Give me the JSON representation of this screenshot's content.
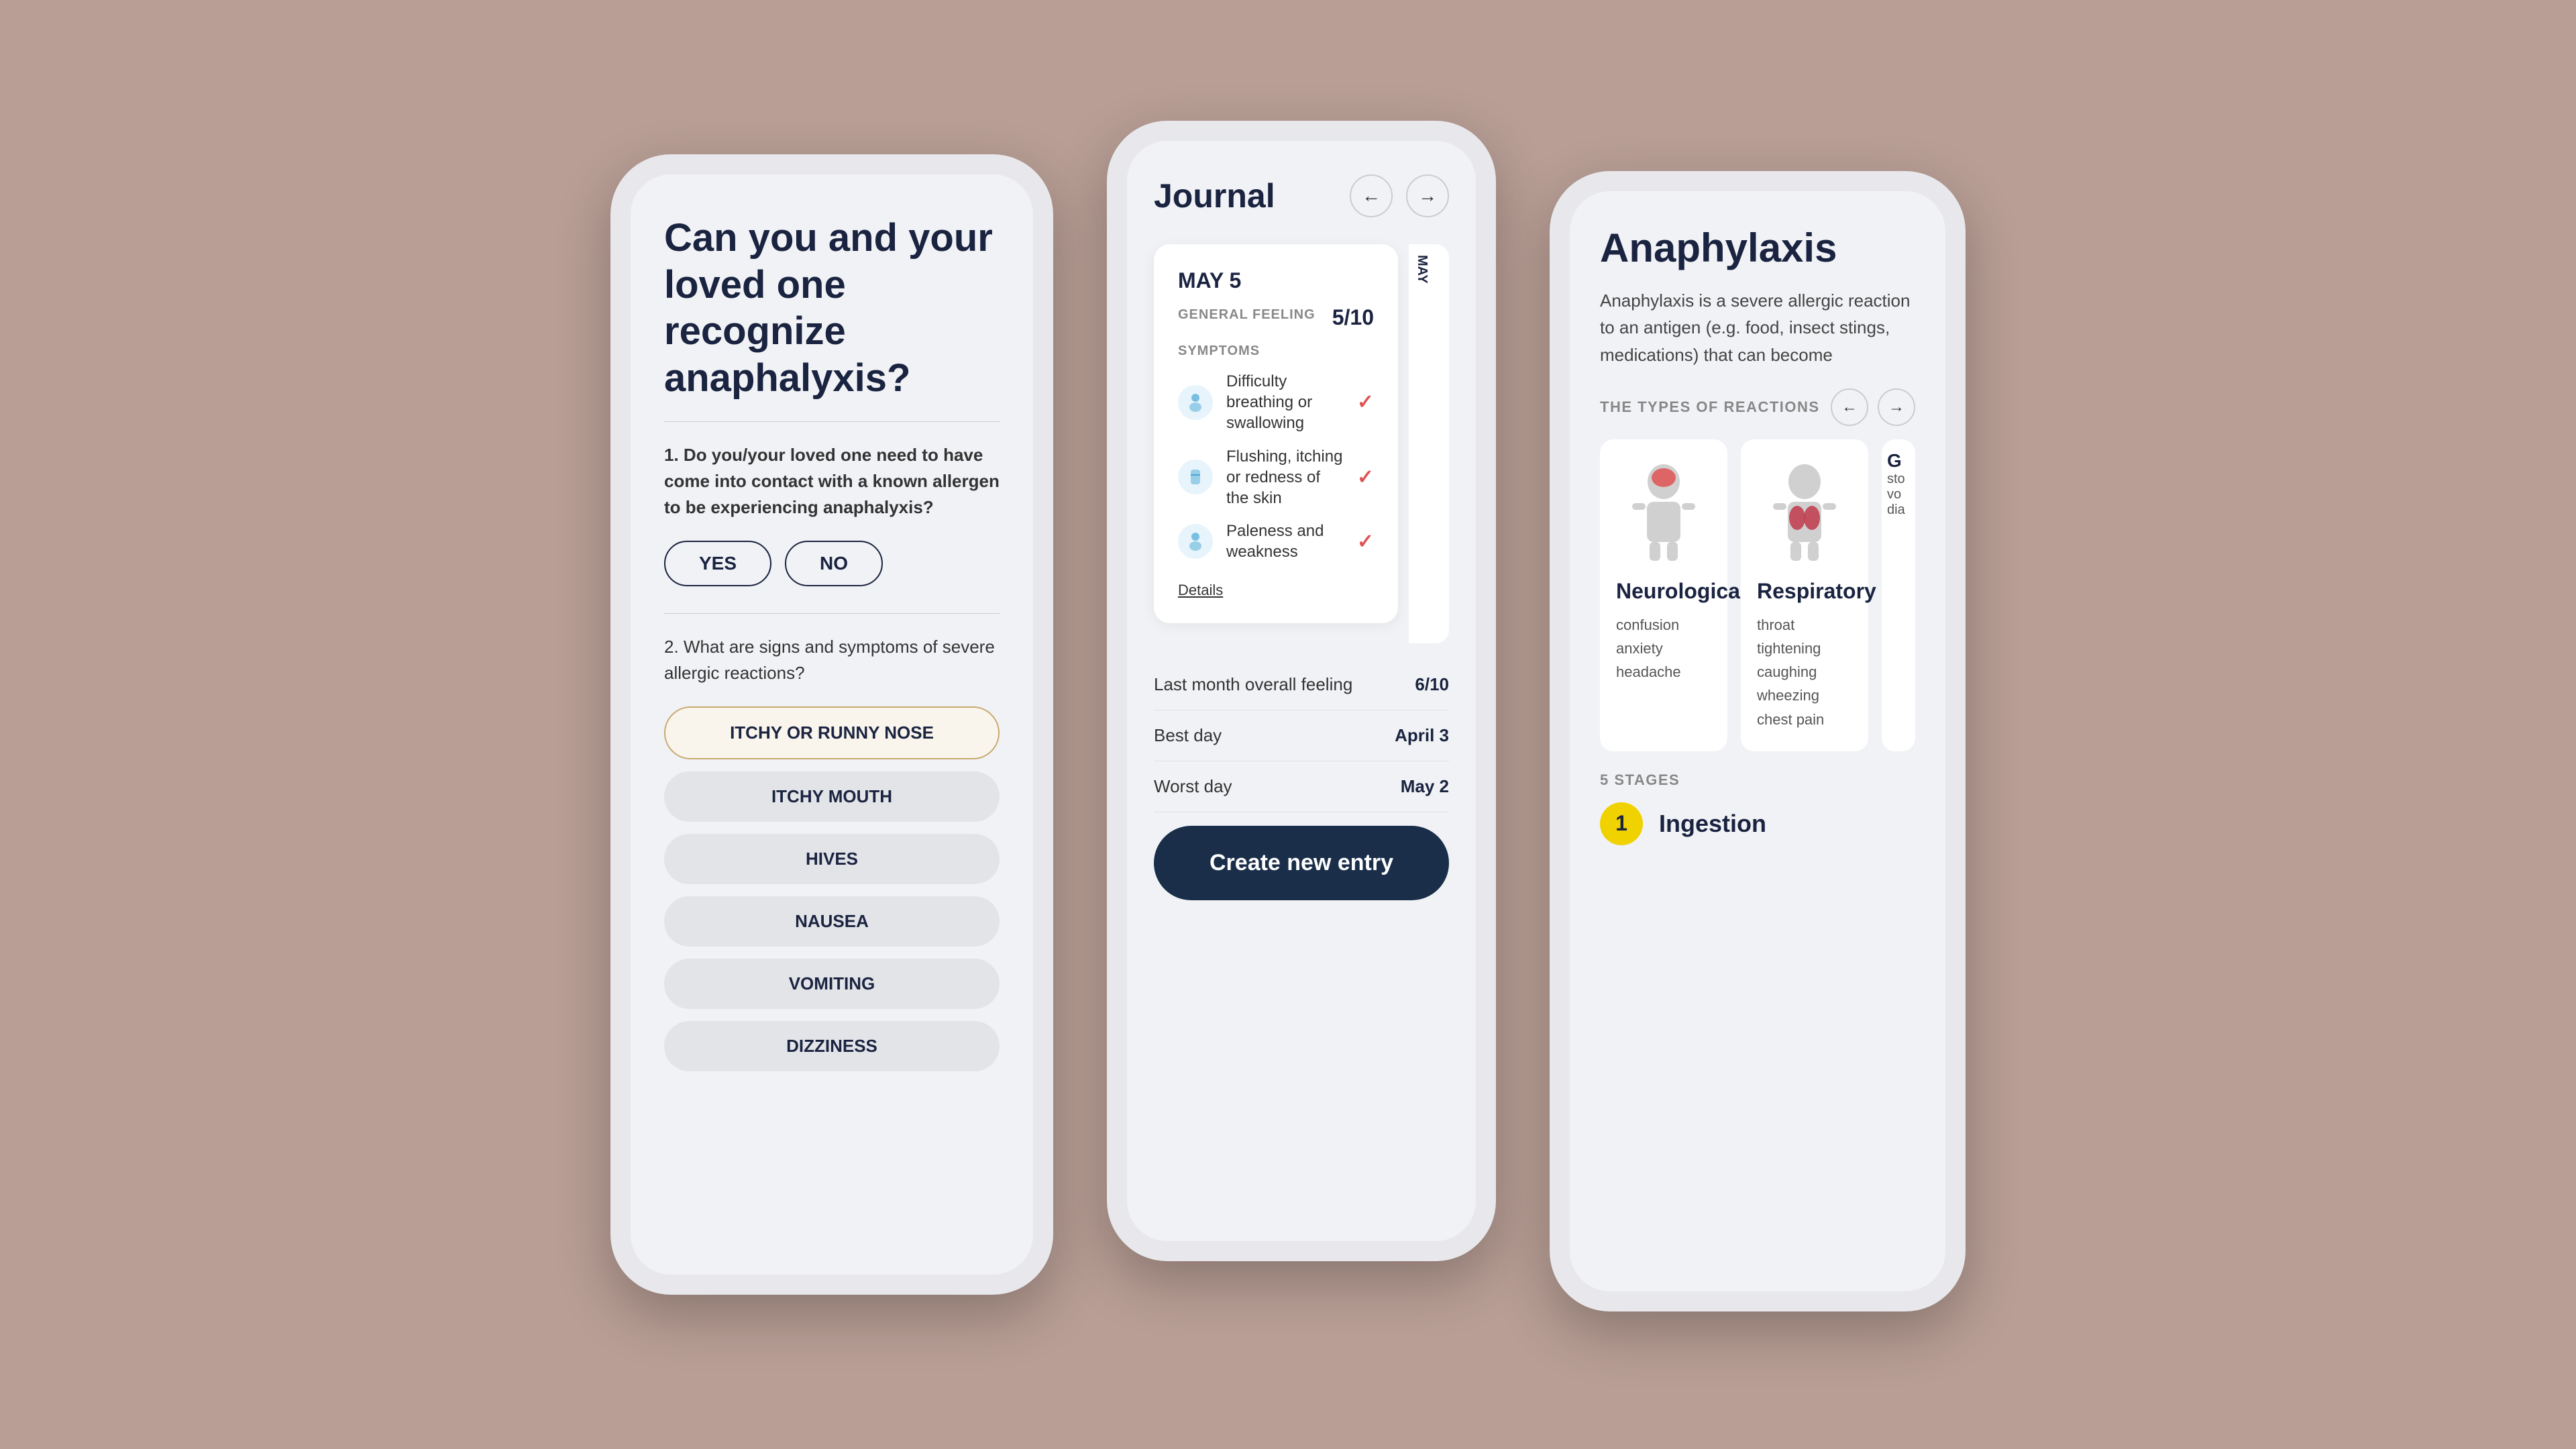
{
  "phone1": {
    "title": "Can you and your loved one recognize anaphalyxis?",
    "question1_text": "Do you/your loved one need to have come into contact with a known allergen to be experiencing anaphalyxis?",
    "question1_num": "1.",
    "btn_yes": "YES",
    "btn_no": "NO",
    "question2_num": "2.",
    "question2_text": "What are signs and symptoms of severe allergic reactions?",
    "options": [
      {
        "label": "ITCHY OR RUNNY NOSE",
        "selected": true
      },
      {
        "label": "ITCHY MOUTH",
        "selected": false
      },
      {
        "label": "HIVES",
        "selected": false
      },
      {
        "label": "NAUSEA",
        "selected": false
      },
      {
        "label": "VOMITING",
        "selected": false
      },
      {
        "label": "DIZZINESS",
        "selected": false
      }
    ]
  },
  "phone2": {
    "title": "Journal",
    "nav_back": "←",
    "nav_fwd": "→",
    "card1": {
      "date": "MAY 5",
      "date_partial": "MAY",
      "general_feeling_label": "GENERAL FEELING",
      "general_feeling_score": "5/10",
      "symptoms_label": "SYMPTOMS",
      "symptoms": [
        {
          "label": "Difficulty breathing or swallowing",
          "checked": true
        },
        {
          "label": "Flushing, itching or redness of the skin",
          "checked": true
        },
        {
          "label": "Paleness and weakness",
          "checked": true
        }
      ],
      "details_link": "Details"
    },
    "stats": [
      {
        "label": "Last month overall feeling",
        "value": "6/10"
      },
      {
        "label": "Best day",
        "value": "April 3"
      },
      {
        "label": "Worst day",
        "value": "May 2"
      }
    ],
    "create_btn": "Create new entry"
  },
  "phone3": {
    "title": "Anaphylaxis",
    "description": "Anaphylaxis is a severe allergic reaction to an antigen (e.g. food, insect stings, medications) that can become",
    "types_label": "THE TYPES OF REACTIONS",
    "nav_back": "←",
    "nav_fwd": "→",
    "reactions": [
      {
        "name": "Neurological",
        "symptoms": "confusion\nanxiety\nheadache",
        "type": "brain"
      },
      {
        "name": "Respiratory",
        "symptoms": "throat tightening\ncaughing\nwheezing\nchest pain",
        "type": "lungs"
      },
      {
        "name": "G",
        "symptoms": "sto\nvo\ndia",
        "type": "partial"
      }
    ],
    "stages_label": "5 STAGES",
    "stage": {
      "num": "1",
      "name": "Ingestion"
    }
  }
}
